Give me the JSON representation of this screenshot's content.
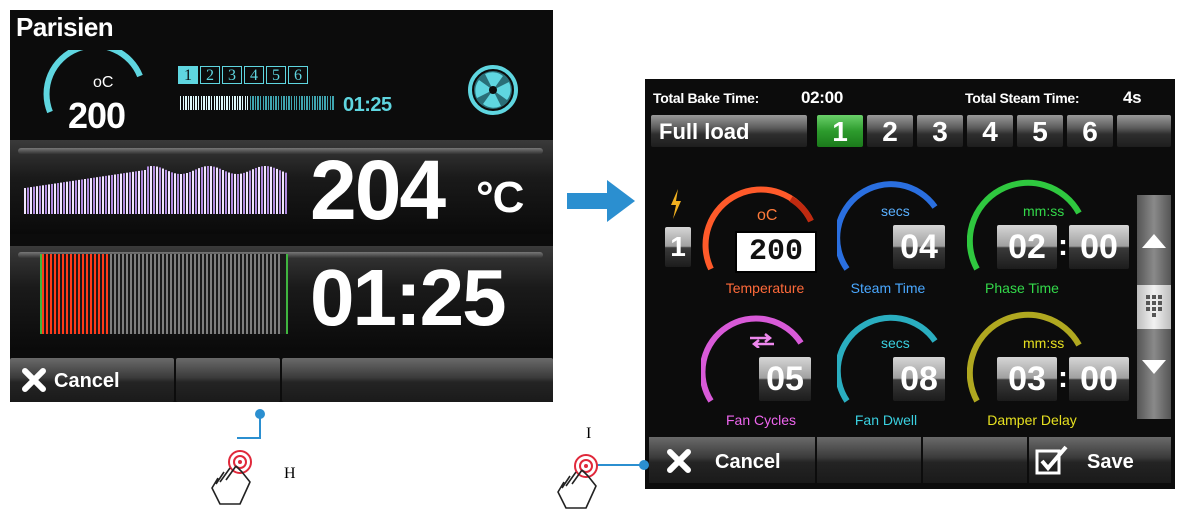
{
  "left_screen": {
    "title": "Parisien",
    "set_temp_unit": "oC",
    "set_temp_value": "200",
    "phases": [
      "1",
      "2",
      "3",
      "4",
      "5",
      "6"
    ],
    "active_phase": 0,
    "phase_progress": 0.45,
    "phase_time": "01:25",
    "current_temp_value": "204",
    "current_temp_unit": "°C",
    "remaining_time": "01:25",
    "timer_progress": 0.28,
    "cancel_label": "Cancel"
  },
  "right_screen": {
    "total_bake_label": "Total Bake Time:",
    "total_bake_value": "02:00",
    "total_steam_label": "Total Steam Time:",
    "total_steam_value": "4s",
    "program_name": "Full load",
    "phases": [
      "1",
      "2",
      "3",
      "4",
      "5",
      "6"
    ],
    "active_phase": 0,
    "current_phase_number": "1",
    "params": [
      {
        "unit": "oC",
        "value": "200",
        "label": "Temperature",
        "color": "#ff5a2a"
      },
      {
        "unit": "secs",
        "value": "04",
        "label": "Steam Time",
        "color": "#3aa0ff"
      },
      {
        "unit": "mm:ss",
        "value_a": "02",
        "value_b": "00",
        "label": "Phase Time",
        "color": "#33d94a"
      },
      {
        "unit": "",
        "value": "05",
        "label": "Fan Cycles",
        "color": "#ee66ee"
      },
      {
        "unit": "secs",
        "value": "08",
        "label": "Fan Dwell",
        "color": "#3ad0e0"
      },
      {
        "unit": "mm:ss",
        "value_a": "03",
        "value_b": "00",
        "label": "Damper Delay",
        "color": "#e6e020"
      }
    ],
    "cancel_label": "Cancel",
    "save_label": "Save"
  },
  "callouts": {
    "left_letter": "H",
    "right_letter": "I"
  },
  "colors": {
    "accent_cyan": "#5fd6e0",
    "arrow_blue": "#2b8fd0",
    "active_tab_green": "#2d9b2d",
    "timer_red": "#ff3a1a"
  }
}
